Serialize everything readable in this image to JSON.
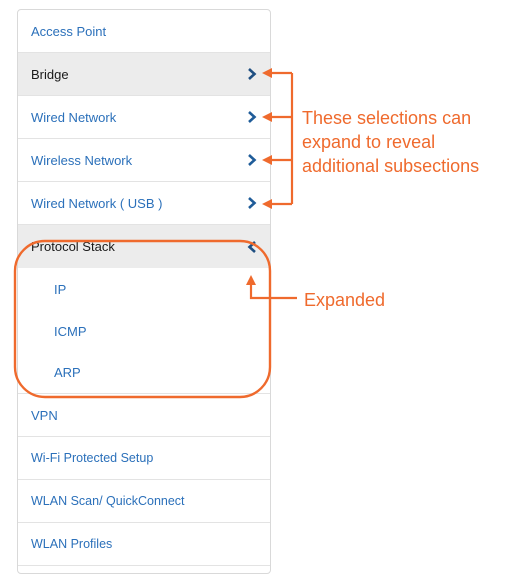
{
  "menu": {
    "items": [
      {
        "label": "Access Point"
      },
      {
        "label": "Bridge"
      },
      {
        "label": "Wired Network"
      },
      {
        "label": "Wireless Network"
      },
      {
        "label": "Wired Network ( USB )"
      },
      {
        "label": "Protocol Stack"
      },
      {
        "label": "IP"
      },
      {
        "label": "ICMP"
      },
      {
        "label": "ARP"
      },
      {
        "label": "VPN"
      },
      {
        "label": "Wi-Fi Protected Setup"
      },
      {
        "label": "WLAN Scan/ QuickConnect"
      },
      {
        "label": "WLAN Profiles"
      }
    ]
  },
  "annotations": {
    "expandable_line1": "These selections can",
    "expandable_line2": "expand to reveal",
    "expandable_line3": "additional subsections",
    "expanded": "Expanded"
  },
  "colors": {
    "link": "#2b70ba",
    "active_bg": "#ececec",
    "annotation": "#ef6a2d",
    "chevron": "#1f5c99"
  }
}
